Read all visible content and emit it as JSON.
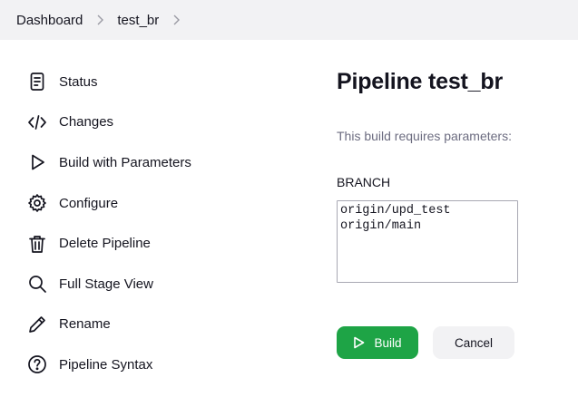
{
  "breadcrumb": {
    "items": [
      "Dashboard",
      "test_br"
    ]
  },
  "sidebar": {
    "items": [
      {
        "label": "Status",
        "icon": "document-icon"
      },
      {
        "label": "Changes",
        "icon": "code-icon"
      },
      {
        "label": "Build with Parameters",
        "icon": "play-icon"
      },
      {
        "label": "Configure",
        "icon": "gear-icon"
      },
      {
        "label": "Delete Pipeline",
        "icon": "trash-icon"
      },
      {
        "label": "Full Stage View",
        "icon": "search-icon"
      },
      {
        "label": "Rename",
        "icon": "pencil-icon"
      },
      {
        "label": "Pipeline Syntax",
        "icon": "help-icon"
      }
    ]
  },
  "main": {
    "title": "Pipeline test_br",
    "subtitle": "This build requires parameters:",
    "parameter": {
      "name": "BRANCH",
      "options": [
        "origin/upd_test",
        "origin/main"
      ]
    }
  },
  "actions": {
    "build_label": "Build",
    "cancel_label": "Cancel"
  },
  "colors": {
    "accent_green": "#1ea446",
    "breadcrumb_bg": "#f2f2f4",
    "muted_text": "#6c6c80"
  }
}
